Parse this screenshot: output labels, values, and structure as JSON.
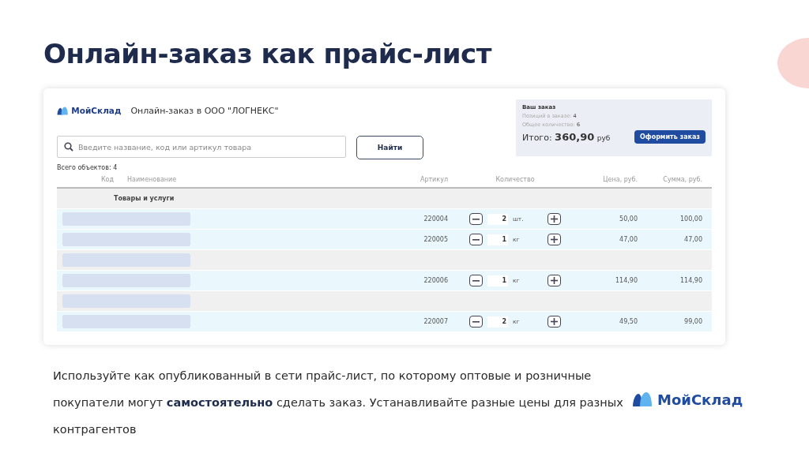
{
  "title": "Онлайн-заказ как прайс-лист",
  "app": {
    "brand": "МойСклад",
    "heading": "Онлайн-заказ в ООО \"ЛОГНЕКС\"",
    "search": {
      "placeholder": "Введите название, код или артикул товара"
    },
    "search_button": "Найти",
    "total_objects": "Всего объектов: 4",
    "order": {
      "title": "Ваш заказ",
      "positions_label": "Позиций в заказе:",
      "positions": "4",
      "quantity_label": "Общее количество:",
      "quantity": "6",
      "total_label": "Итого:",
      "total": "360,90",
      "currency": "руб",
      "checkout": "Оформить заказ"
    },
    "columns": [
      "Код",
      "Наименование",
      "Артикул",
      "Количество",
      "Цена, руб.",
      "Сумма, руб."
    ],
    "group_title": "Товары и услуги",
    "rows": [
      {
        "kind": "item",
        "article": "220004",
        "qty": "2",
        "unit": "шт.",
        "price": "50,00",
        "sum": "100,00"
      },
      {
        "kind": "item",
        "article": "220005",
        "qty": "1",
        "unit": "кг",
        "price": "47,00",
        "sum": "47,00"
      },
      {
        "kind": "group"
      },
      {
        "kind": "item",
        "article": "220006",
        "qty": "1",
        "unit": "кг",
        "price": "114,90",
        "sum": "114,90"
      },
      {
        "kind": "group"
      },
      {
        "kind": "item",
        "article": "220007",
        "qty": "2",
        "unit": "кг",
        "price": "49,50",
        "sum": "99,00"
      }
    ]
  },
  "description": "Используйте как опубликованный в сети прайс-лист, по которому оптовые и розничные покупатели могут **самостоятельно** сделать заказ. Устанавливайте разные цены для разных контрагентов",
  "footer_brand": "МойСклад"
}
